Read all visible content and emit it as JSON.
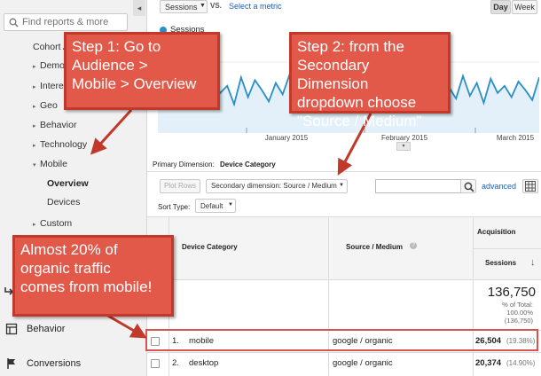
{
  "sidebar": {
    "search_placeholder": "Find reports & more",
    "collapse_icon": "◂",
    "items": [
      {
        "label": "Cohort A",
        "arrow": ""
      },
      {
        "label": "Demog",
        "arrow": "▸"
      },
      {
        "label": "Interes",
        "arrow": "▸"
      },
      {
        "label": "Geo",
        "arrow": "▸"
      },
      {
        "label": "Behavior",
        "arrow": "▸"
      },
      {
        "label": "Technology",
        "arrow": "▸"
      },
      {
        "label": "Mobile",
        "arrow": "▾"
      },
      {
        "label": "Overview",
        "arrow": ""
      },
      {
        "label": "Devices",
        "arrow": ""
      },
      {
        "label": "Custom",
        "arrow": "▸"
      }
    ],
    "bottom": [
      {
        "label": "Behavior",
        "icon": "behavior-icon"
      },
      {
        "label": "Conversions",
        "icon": "flag-icon"
      }
    ]
  },
  "toolbar": {
    "metric": "Sessions",
    "vs": "VS.",
    "select_metric": "Select a metric",
    "day": "Day",
    "week": "Week"
  },
  "chart": {
    "legend": "Sessions",
    "x_labels": [
      "January 2015",
      "February 2015",
      "March 2015"
    ]
  },
  "chart_data": {
    "type": "line",
    "series": [
      {
        "name": "Sessions",
        "values": [
          55,
          48,
          62,
          45,
          58,
          50,
          66,
          47,
          60,
          52,
          57,
          44,
          63,
          49,
          61,
          54,
          46,
          59,
          51,
          65,
          48,
          56,
          50,
          62,
          45,
          58,
          53,
          47,
          64,
          50,
          57,
          52,
          60,
          46,
          55,
          49,
          63,
          51,
          58,
          47,
          61,
          53,
          56,
          48,
          64,
          50,
          59,
          45,
          62,
          52,
          57,
          49,
          60,
          54,
          47,
          63
        ]
      }
    ],
    "xlabel": "",
    "ylabel": ""
  },
  "primary_dimension": {
    "label": "Primary Dimension:",
    "value": "Device Category"
  },
  "controls": {
    "plot_rows": "Plot Rows",
    "secondary_dimension": "Secondary dimension: Source / Medium",
    "advanced": "advanced",
    "sort_type_label": "Sort Type:",
    "sort_type_value": "Default"
  },
  "table": {
    "headers": {
      "device": "Device Category",
      "source": "Source / Medium",
      "acquisition": "Acquisition",
      "sessions": "Sessions"
    },
    "total": {
      "value": "136,750",
      "pct_line1": "% of Total:",
      "pct_line2": "100.00%",
      "pct_line3": "(136,750)"
    },
    "rows": [
      {
        "num": "1.",
        "device": "mobile",
        "source": "google / organic",
        "sessions": "26,504",
        "pct": "(19.38%)"
      },
      {
        "num": "2.",
        "device": "desktop",
        "source": "google / organic",
        "sessions": "20,374",
        "pct": "(14.90%)"
      }
    ]
  },
  "callouts": {
    "step1": [
      "Step 1: Go to",
      "Audience  >",
      "Mobile > Overview"
    ],
    "step2": [
      "Step 2: from the",
      "Secondary Dimension",
      "dropdown choose",
      "\"Source / Medium\""
    ],
    "note": [
      "Almost 20% of",
      "organic traffic",
      "comes from mobile!"
    ]
  },
  "colors": {
    "accent": "#1a5fb4",
    "callout": "#e2594a",
    "highlight": "#d9534f",
    "line": "#2a8fc7"
  }
}
